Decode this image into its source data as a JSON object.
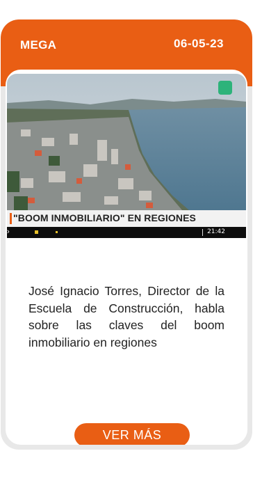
{
  "card": {
    "source": "MEGA",
    "date": "06-05-23",
    "image": {
      "caption": "\"BOOM INMOBILIARIO\" EN REGIONES",
      "ticker_time": "21:42",
      "logo_icon": "mega-noticias-logo-icon"
    },
    "description": "José Ignacio Torres, Director de la Escuela de Construcción, habla sobre las claves del boom inmobiliario en regiones",
    "button_label": "VER MÁS"
  },
  "colors": {
    "accent": "#e95e14",
    "frame": "#e8e8e8",
    "text": "#222222"
  }
}
